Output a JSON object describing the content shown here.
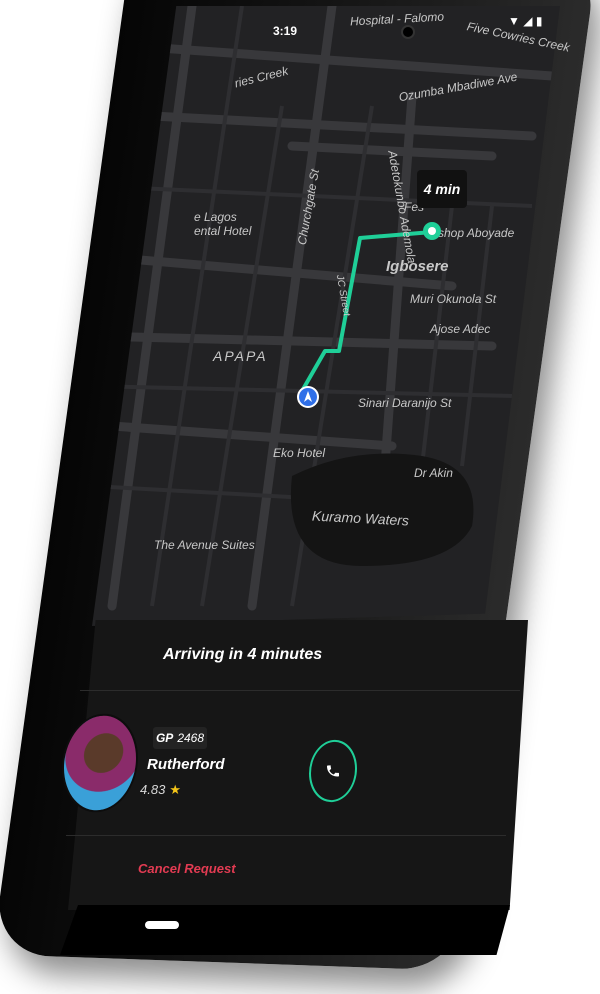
{
  "status_bar": {
    "time": "3:19"
  },
  "map": {
    "labels": {
      "hospital": "Hospital - Falomo",
      "five_cowries": "Five Cowries Creek",
      "cowries_creek": "ries Creek",
      "ozumba": "Ozumba Mbadiwe Ave",
      "adetokunbo": "Adetokunbo Ademola",
      "churchgate": "Churchgate St",
      "lagos_hotel": "e Lagos\nental Hotel",
      "festac": "Fes",
      "bishop": "shop Aboyade",
      "igbosere": "Igbosere",
      "muri": "Muri Okunola St",
      "ajose": "Ajose Adec",
      "apapa": "APAPA",
      "sinari": "Sinari Daranijo St",
      "eko_hotel": "Eko Hotel",
      "dr_akin": "Dr Akin",
      "kuramo": "Kuramo Waters",
      "avenue_suites": "The Avenue Suites",
      "jc_street": "JC Street"
    },
    "eta_bubble": "4 min",
    "colors": {
      "route": "#1fcf98",
      "map_bg": "#222224",
      "roads": "#3a3a3d",
      "user_dot": "#2f6fe8"
    }
  },
  "sheet": {
    "title": "Arriving in 4 minutes",
    "driver": {
      "plate_prefix": "GP",
      "plate_number": "2468",
      "name": "Rutherford",
      "rating": "4.83"
    },
    "cancel_label": "Cancel Request",
    "colors": {
      "accent": "#1fcf98",
      "cancel": "#e23b52",
      "star": "#f4c518"
    }
  },
  "icons": {
    "call": "phone-icon",
    "star": "star-icon",
    "user_location": "navigation-arrow-icon",
    "destination": "destination-pin-icon"
  }
}
